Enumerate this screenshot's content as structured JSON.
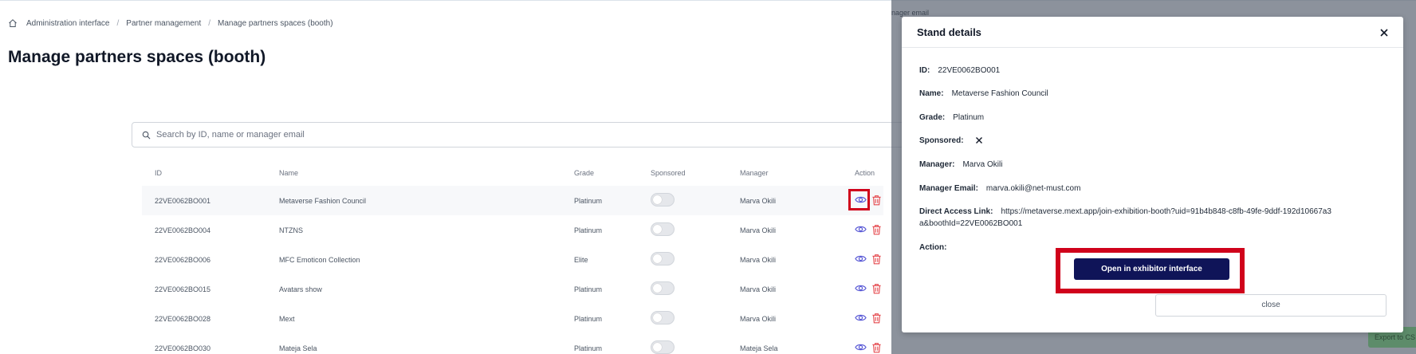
{
  "breadcrumb": {
    "home_icon": "home-icon",
    "items": [
      "Administration interface",
      "Partner management",
      "Manage partners spaces (booth)"
    ],
    "separator": "/"
  },
  "page": {
    "title": "Manage partners spaces (booth)"
  },
  "search": {
    "placeholder": "Search by ID, name or manager email",
    "icon": "search-icon"
  },
  "table": {
    "headers": {
      "id": "ID",
      "name": "Name",
      "grade": "Grade",
      "sponsored": "Sponsored",
      "manager": "Manager",
      "action": "Action"
    },
    "rows": [
      {
        "id": "22VE0062BO001",
        "name": "Metaverse Fashion Council",
        "grade": "Platinum",
        "sponsored": false,
        "manager": "Marva Okili"
      },
      {
        "id": "22VE0062BO004",
        "name": "NTZNS",
        "grade": "Platinum",
        "sponsored": false,
        "manager": "Marva Okili"
      },
      {
        "id": "22VE0062BO006",
        "name": "MFC Emoticon Collection",
        "grade": "Elite",
        "sponsored": false,
        "manager": "Marva Okili"
      },
      {
        "id": "22VE0062BO015",
        "name": "Avatars show",
        "grade": "Platinum",
        "sponsored": false,
        "manager": "Marva Okili"
      },
      {
        "id": "22VE0062BO028",
        "name": "Mext",
        "grade": "Platinum",
        "sponsored": false,
        "manager": "Marva Okili"
      },
      {
        "id": "22VE0062BO030",
        "name": "Mateja Sela",
        "grade": "Platinum",
        "sponsored": false,
        "manager": "Mateja Sela"
      }
    ]
  },
  "overlay": {
    "ghost_text": "nager email",
    "export_label": "Export to CS"
  },
  "modal": {
    "title": "Stand details",
    "fields": {
      "id": {
        "label": "ID:",
        "value": "22VE0062BO001"
      },
      "name": {
        "label": "Name:",
        "value": "Metaverse Fashion Council"
      },
      "grade": {
        "label": "Grade:",
        "value": "Platinum"
      },
      "sponsored": {
        "label": "Sponsored:",
        "icon": "x-icon"
      },
      "manager": {
        "label": "Manager:",
        "value": "Marva Okili"
      },
      "manager_email": {
        "label": "Manager Email:",
        "value": "marva.okili@net-must.com"
      },
      "direct_link": {
        "label": "Direct Access Link:",
        "value": "https://metaverse.mext.app/join-exhibition-booth?uid=91b4b848-c8fb-49fe-9ddf-192d10667a3a&boothId=22VE0062BO001"
      },
      "action": {
        "label": "Action:"
      }
    },
    "primary_button": "Open in exhibitor interface",
    "close_button": "close"
  },
  "colors": {
    "accent_blue": "#0f1458",
    "highlight_red": "#d0021b",
    "eye_icon": "#5b5bd6",
    "trash_icon": "#e5484d",
    "overlay": "#5f6876"
  }
}
